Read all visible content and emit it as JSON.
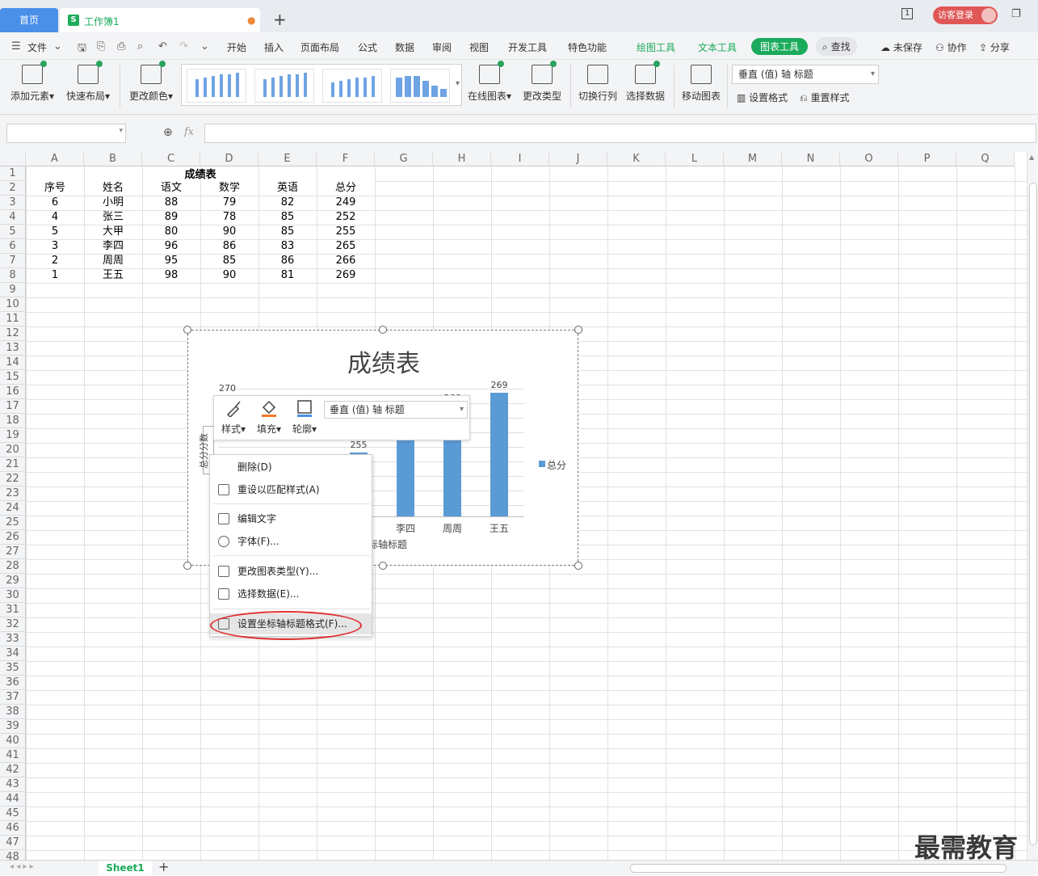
{
  "tabs": {
    "home": "首页",
    "doc": "工作簿1",
    "doc_icon": "S"
  },
  "header": {
    "login": "访客登录",
    "page_indicator": "1"
  },
  "menu": {
    "file": "文件",
    "items": [
      "开始",
      "插入",
      "页面布局",
      "公式",
      "数据",
      "审阅",
      "视图",
      "开发工具",
      "特色功能"
    ],
    "ctx_tabs": [
      "绘图工具",
      "文本工具",
      "图表工具"
    ],
    "search": "查找",
    "right": [
      "未保存",
      "协作",
      "分享"
    ]
  },
  "ribbon": {
    "add_element": "添加元素",
    "quick_layout": "快速布局",
    "change_color": "更改颜色",
    "online_chart": "在线图表",
    "change_type": "更改类型",
    "switch_rowcol": "切换行列",
    "select_data": "选择数据",
    "move_chart": "移动图表",
    "element_combo": "垂直 (值) 轴 标题",
    "set_format": "设置格式",
    "reset_style": "重置样式"
  },
  "formula": {
    "fx": "fx"
  },
  "columns": [
    "A",
    "B",
    "C",
    "D",
    "E",
    "F",
    "G",
    "H",
    "I",
    "J",
    "K",
    "L",
    "M",
    "N",
    "O",
    "P",
    "Q"
  ],
  "rows": [
    "1",
    "2",
    "3",
    "4",
    "5",
    "6",
    "7",
    "8",
    "9",
    "10",
    "11",
    "12",
    "13",
    "14",
    "15",
    "16",
    "17",
    "18",
    "19",
    "20",
    "21",
    "22",
    "23",
    "24",
    "25",
    "26",
    "27",
    "28",
    "29",
    "30",
    "31",
    "32",
    "33",
    "34",
    "35",
    "36",
    "37",
    "38",
    "39",
    "40",
    "41",
    "42",
    "43",
    "44",
    "45",
    "46",
    "47",
    "48"
  ],
  "sheet": {
    "title": "成绩表",
    "headers": [
      "序号",
      "姓名",
      "语文",
      "数学",
      "英语",
      "总分"
    ],
    "data": [
      [
        "6",
        "小明",
        "88",
        "79",
        "82",
        "249"
      ],
      [
        "4",
        "张三",
        "89",
        "78",
        "85",
        "252"
      ],
      [
        "5",
        "大甲",
        "80",
        "90",
        "85",
        "255"
      ],
      [
        "3",
        "李四",
        "96",
        "86",
        "83",
        "265"
      ],
      [
        "2",
        "周周",
        "95",
        "85",
        "86",
        "266"
      ],
      [
        "1",
        "王五",
        "98",
        "90",
        "81",
        "269"
      ]
    ]
  },
  "chart_data": {
    "type": "bar",
    "title": "成绩表",
    "categories": [
      "小明",
      "张三",
      "大甲",
      "李四",
      "周周",
      "王五"
    ],
    "series": [
      {
        "name": "总分",
        "values": [
          249,
          252,
          255,
          265,
          266,
          269
        ],
        "color": "#5b9bd5"
      }
    ],
    "ylabel": "总分分数",
    "xlabel": "标轴标题",
    "visible_tick_top": "270",
    "ylim": [
      240,
      270
    ],
    "legend": "right"
  },
  "minibar": {
    "style": "样式",
    "fill": "填充",
    "outline": "轮廓",
    "combo": "垂直 (值) 轴 标题"
  },
  "context_menu": [
    {
      "label": "删除(D)",
      "icon": "delete-icon"
    },
    {
      "label": "重设以匹配样式(A)",
      "icon": "reset-style-icon"
    },
    {
      "label": "编辑文字",
      "icon": "edit-text-icon"
    },
    {
      "label": "字体(F)...",
      "icon": "font-icon"
    },
    {
      "label": "更改图表类型(Y)...",
      "icon": "chart-type-icon"
    },
    {
      "label": "选择数据(E)...",
      "icon": "select-data-icon"
    },
    {
      "label": "设置坐标轴标题格式(F)...",
      "icon": "format-axis-title-icon"
    }
  ],
  "footer": {
    "sheet_tab": "Sheet1",
    "add_sheet": "+"
  },
  "watermark": "最需教育"
}
